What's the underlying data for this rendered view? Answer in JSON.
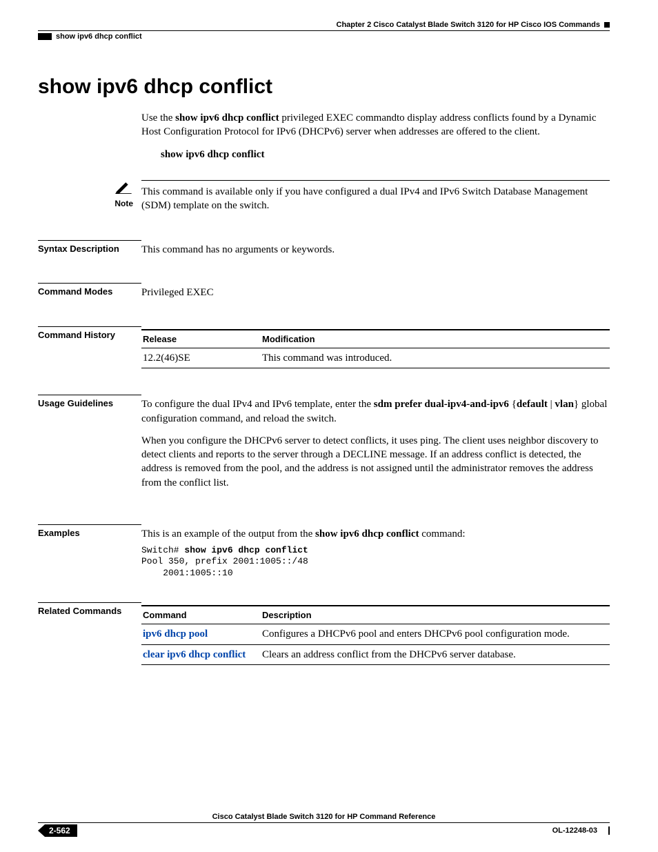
{
  "header": {
    "chapter": "Chapter 2  Cisco Catalyst Blade Switch 3120 for HP Cisco IOS Commands",
    "running_head": "show ipv6 dhcp conflict"
  },
  "title": "show ipv6 dhcp conflict",
  "intro": {
    "prefix": "Use the ",
    "cmd_bold": "show ipv6 dhcp conflict",
    "suffix": " privileged EXEC commandto display address conflicts found by a Dynamic Host Configuration Protocol for IPv6 (DHCPv6) server when addresses are offered to the client."
  },
  "syntax_line": "show ipv6 dhcp conflict",
  "note": {
    "label": "Note",
    "text": "This command is available only if you have configured a dual IPv4 and IPv6 Switch Database Management (SDM) template on the switch."
  },
  "sections": {
    "syntax_description": {
      "label": "Syntax Description",
      "text": "This command has no arguments or keywords."
    },
    "command_modes": {
      "label": "Command Modes",
      "text": "Privileged EXEC"
    },
    "command_history": {
      "label": "Command History",
      "headers": {
        "release": "Release",
        "modification": "Modification"
      },
      "rows": [
        {
          "release": "12.2(46)SE",
          "modification": "This command was introduced."
        }
      ]
    },
    "usage_guidelines": {
      "label": "Usage Guidelines",
      "p1_a": "To configure the dual IPv4 and IPv6 template, enter the ",
      "p1_b": "sdm prefer dual-ipv4-and-ipv6",
      "p1_c": " {",
      "p1_d": "default",
      "p1_e": " | ",
      "p1_f": "vlan",
      "p1_g": "} global configuration command, and reload the switch.",
      "p2": "When you configure the DHCPv6 server to detect conflicts, it uses ping. The client uses neighbor discovery to detect clients and reports to the server through a DECLINE message. If an address conflict is detected, the address is removed from the pool, and the address is not assigned until the administrator removes the address from the conflict list."
    },
    "examples": {
      "label": "Examples",
      "lead_a": "This is an example of the output from the ",
      "lead_b": "show ipv6 dhcp conflict",
      "lead_c": " command:",
      "code_prompt": "Switch# ",
      "code_cmd": "show ipv6 dhcp conflict",
      "code_line2": "Pool 350, prefix 2001:1005::/48",
      "code_line3": "    2001:1005::10"
    },
    "related_commands": {
      "label": "Related Commands",
      "headers": {
        "command": "Command",
        "description": "Description"
      },
      "rows": [
        {
          "command": "ipv6 dhcp pool",
          "description": "Configures a DHCPv6 pool and enters DHCPv6 pool configuration mode."
        },
        {
          "command": "clear ipv6 dhcp conflict",
          "description": "Clears an address conflict from the DHCPv6 server database."
        }
      ]
    }
  },
  "footer": {
    "book": "Cisco Catalyst Blade Switch 3120 for HP Command Reference",
    "page": "2-562",
    "docid": "OL-12248-03"
  }
}
